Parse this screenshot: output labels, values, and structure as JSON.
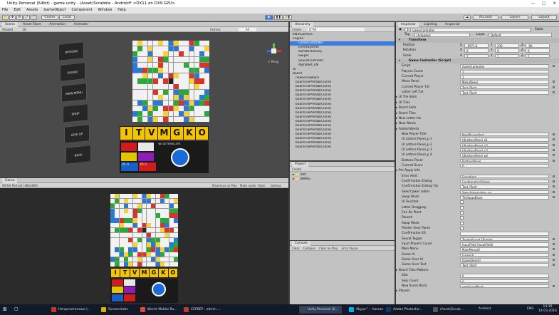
{
  "window": {
    "title": "Unity Personal (64bit) - game.unity - (Asset)Scrabble - Android* <DX11 on DX9 GPU>"
  },
  "menus": [
    "File",
    "Edit",
    "Assets",
    "GameObject",
    "Component",
    "Window",
    "Help"
  ],
  "toolbar": {
    "pivot": "Center",
    "space": "Local",
    "account": "Account",
    "layers": "Layers",
    "layout": "Layout"
  },
  "scene": {
    "tabs": [
      "Scene",
      "Asset Store",
      "Animation",
      "Animator"
    ],
    "shading": "Shaded",
    "mode": "2D",
    "gizmos": "Gizmos",
    "search": "All",
    "persp": "< Persp"
  },
  "game_menu": {
    "items": [
      "OPTIONS",
      "SOUND",
      "MAIN MENU",
      "SHOP",
      "GIVE UP",
      "BACK"
    ]
  },
  "game_ui": {
    "letters": [
      "I",
      "T",
      "V",
      "M",
      "G",
      "K",
      "O"
    ],
    "no_letters": "NO LETTERS LEFT",
    "p1": "P1",
    "p2": "P2",
    "p1_score": "0",
    "p2_score": "0"
  },
  "game": {
    "tab": "Game",
    "resolution": "WVGA Portrait (480x800)",
    "maximize": "Maximize on Play",
    "mute": "Mute audio",
    "stats": "Stats",
    "gizmos": "Gizmos"
  },
  "hierarchy": {
    "tab": "Hierarchy",
    "create": "Create",
    "search": "Q*All",
    "items": [
      "MainCamera",
      "Engine",
      "GameController",
      "EventSystem",
      "wordDictionary",
      "Swiper",
      "SoundController",
      "Alphabet_EN",
      "UI",
      "Board",
      "newScoreBlock",
      "boardTilePrefab(Clone)",
      "boardTilePrefab(Clone)",
      "boardTilePrefab(Clone)",
      "boardTilePrefab(Clone)",
      "boardTilePrefab(Clone)",
      "boardTilePrefab(Clone)",
      "boardTilePrefab(Clone)",
      "boardTilePrefab(Clone)",
      "boardTilePrefab(Clone)",
      "boardTilePrefab(Clone)",
      "boardTilePrefab(Clone)",
      "boardTilePrefab(Clone)",
      "boardTilePrefab(Clone)",
      "boardTilePrefab(Clone)",
      "boardTilePrefab(Clone)",
      "boardTilePrefab(Clone)"
    ]
  },
  "project": {
    "tab": "Project",
    "create": "Create",
    "items": [
      "Inkt",
      "WMRG"
    ]
  },
  "console": {
    "tab": "Console",
    "buttons": [
      "Clear",
      "Collapse",
      "Clear on Play",
      "Error Pause"
    ]
  },
  "inspector": {
    "tabs": [
      "Inspector",
      "Lighting",
      "Inspector"
    ],
    "object": "GameController",
    "static": "Static",
    "tag_label": "Tag",
    "tag": "Untagged",
    "layer_label": "Layer",
    "layer": "Default",
    "transform": {
      "title": "Transform",
      "rows": [
        {
          "label": "Position",
          "x": "-2971.6",
          "y": "230",
          "z": "-90"
        },
        {
          "label": "Rotation",
          "x": "0",
          "y": "0",
          "z": "0"
        },
        {
          "label": "Scale",
          "x": "1",
          "y": "1",
          "z": "1"
        }
      ]
    },
    "component": "Game Controller (Script)",
    "fields": [
      {
        "label": "Script",
        "value": "GameController",
        "type": "field"
      },
      {
        "label": "Players Count",
        "value": "2",
        "type": "field"
      },
      {
        "label": "Current Player",
        "value": "1",
        "type": "field"
      },
      {
        "label": "Menu Panel",
        "value": "MenuPanel",
        "type": "field"
      },
      {
        "label": "Current Player Txt",
        "value": "Text (Text)",
        "type": "field"
      },
      {
        "label": "Letter Left Txt",
        "value": "Text (Text)",
        "type": "field"
      },
      {
        "label": "UI Tile Slots",
        "value": "",
        "type": "fold"
      },
      {
        "label": "UI Tiles",
        "value": "",
        "type": "fold"
      },
      {
        "label": "Board Slots",
        "value": "",
        "type": "fold"
      },
      {
        "label": "Board Tiles",
        "value": "",
        "type": "fold"
      },
      {
        "label": "New Letter Ids",
        "value": "",
        "type": "fold"
      },
      {
        "label": "New Words",
        "value": "",
        "type": "fold"
      },
      {
        "label": "Added Words",
        "value": "",
        "type": "fold"
      },
      {
        "label": "New Player Title",
        "value": "NewPlayerAlert",
        "type": "field"
      },
      {
        "label": "UI Letters Panel_p 1",
        "value": "UILettersPanel_p1",
        "type": "field"
      },
      {
        "label": "UI Letters Panel_p 2",
        "value": "UILettersPanel_p2",
        "type": "field"
      },
      {
        "label": "UI Letters Panel_p 3",
        "value": "UILettersPanel_p3",
        "type": "field"
      },
      {
        "label": "UI Letters Panel_p 4",
        "value": "UILettersPanel_p4",
        "type": "field"
      },
      {
        "label": "Buttons Panel",
        "value": "ButtonsPanel",
        "type": "field"
      },
      {
        "label": "Current Score",
        "value": "0",
        "type": "field"
      },
      {
        "label": "Pre Apply Info",
        "value": "",
        "type": "fold"
      },
      {
        "label": "Error Alert",
        "value": "ErrorAlert",
        "type": "field"
      },
      {
        "label": "Confirmation Dialog",
        "value": "ConfirmationDialog",
        "type": "field"
      },
      {
        "label": "Confirmation Dialog Txt",
        "value": "Text (Text)",
        "type": "field"
      },
      {
        "label": "Select Joker Letter",
        "value": "SelectJokerLetter_en",
        "type": "field"
      },
      {
        "label": "Swap Block",
        "value": "TileSwapBlock",
        "type": "field"
      },
      {
        "label": "UI Touched",
        "value": "",
        "type": "check"
      },
      {
        "label": "Letter Dragging",
        "value": "",
        "type": "check"
      },
      {
        "label": "Can Be Plant",
        "value": "",
        "type": "check"
      },
      {
        "label": "Paused",
        "value": "",
        "type": "check"
      },
      {
        "label": "Swap Mode",
        "value": "",
        "type": "check"
      },
      {
        "label": "Pointer Over Panel",
        "value": "",
        "type": "check"
      },
      {
        "label": "Confirmation ID",
        "value": "",
        "type": "field"
      },
      {
        "label": "Sound Toggle",
        "value": "ToggleSound (Toggle)",
        "type": "field"
      },
      {
        "label": "Input Players Count",
        "value": "InputField (InputField)",
        "type": "field"
      },
      {
        "label": "Main Menu",
        "value": "MainMenuUI",
        "type": "field"
      },
      {
        "label": "Game UI",
        "value": "GameUI",
        "type": "field"
      },
      {
        "label": "Game Over UI",
        "value": "GameOverUI",
        "type": "field"
      },
      {
        "label": "Game Over Text",
        "value": "Text (Text)",
        "type": "field"
      },
      {
        "label": "Board Tiles Matters",
        "value": "",
        "type": "fold"
      },
      {
        "label": "Size",
        "value": "0",
        "type": "field"
      },
      {
        "label": "Skip Count",
        "value": "0",
        "type": "field"
      },
      {
        "label": "New Score Block",
        "value": "newScoreBlock",
        "type": "field"
      },
      {
        "label": "Players",
        "value": "",
        "type": "fold"
      }
    ]
  },
  "taskbar": {
    "items": [
      {
        "label": "Непрочитанные (..",
        "color": "#c0392b"
      },
      {
        "label": "Screenshots",
        "color": "#e0b000"
      },
      {
        "label": "Words Mobile Ro...",
        "color": "#dd4b39"
      },
      {
        "label": "СЕРВЕР - admin ...",
        "color": "#c0392b"
      },
      {
        "label": "Unity Personal (6...",
        "color": "#444"
      },
      {
        "label": "Skype™ - hassan...",
        "color": "#00aff0"
      },
      {
        "label": "Adobe Photosho...",
        "color": "#0b3a6b"
      },
      {
        "label": "(Asset)Scrab...",
        "color": "#555"
      }
    ],
    "tray": "Android",
    "lang": "ENG",
    "time": "14:36",
    "date": "14.03.2016"
  }
}
